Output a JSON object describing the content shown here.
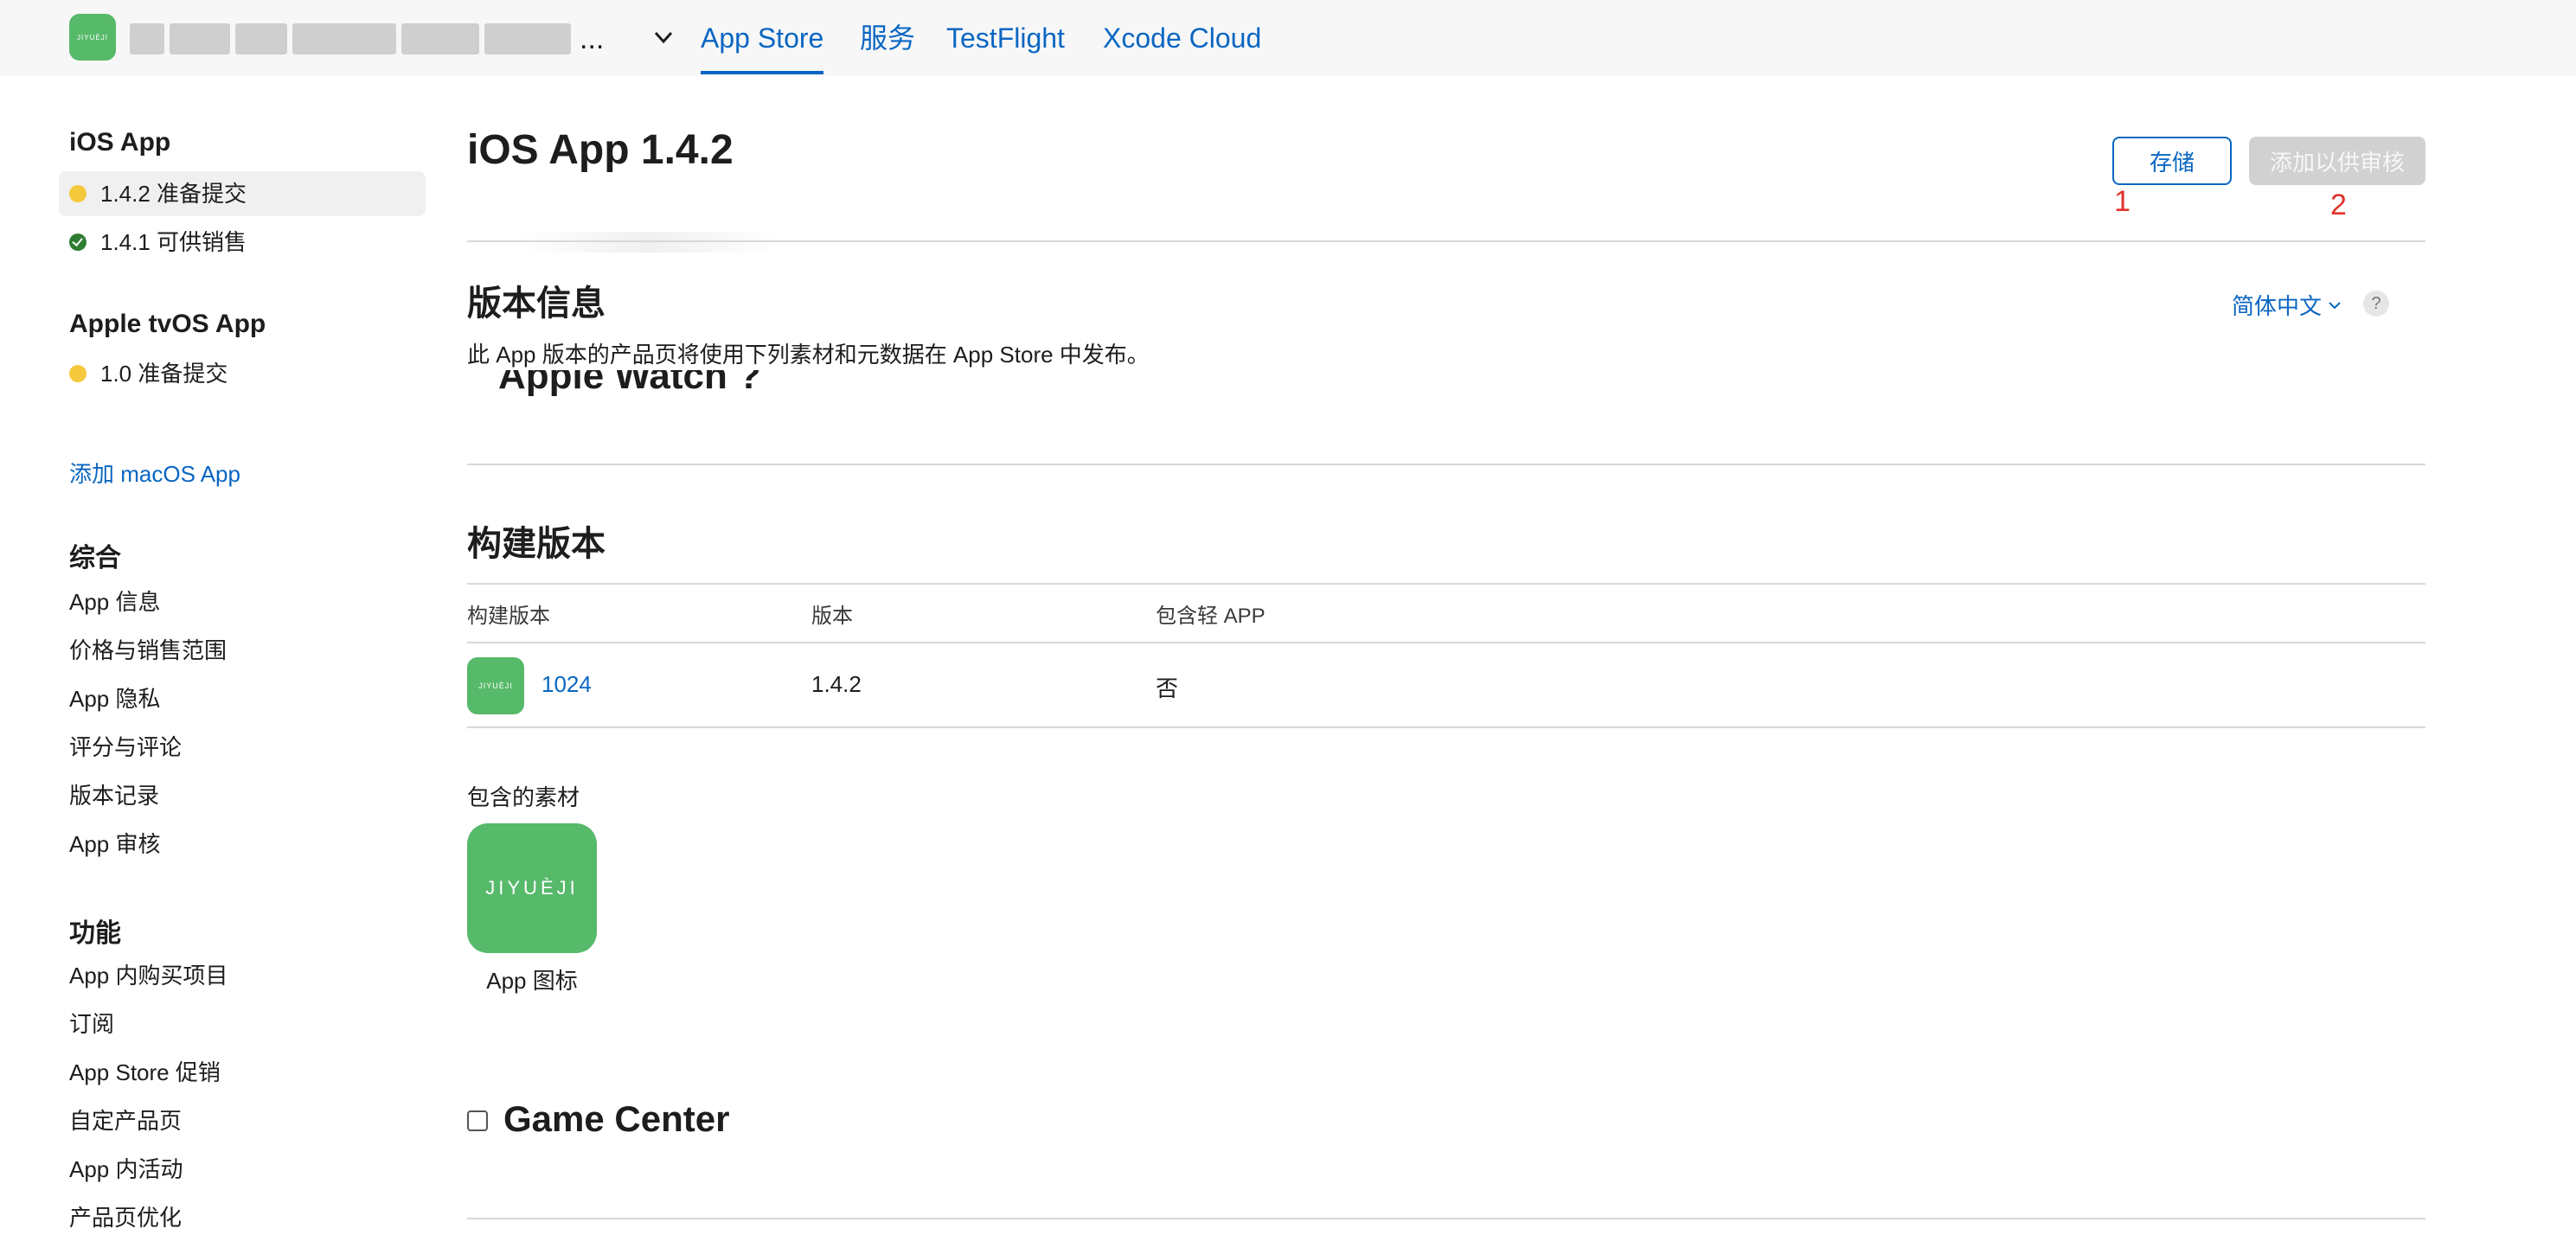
{
  "colors": {
    "accent": "#0a66c2",
    "app_green": "#57b96a",
    "status_yellow": "#f5c93c",
    "status_green": "#2e7d32",
    "annotation_red": "#e0332b"
  },
  "header": {
    "app_logo_text": "JIYUÈJI",
    "app_name_ellipsis": "...",
    "tabs": [
      "App Store",
      "服务",
      "TestFlight",
      "Xcode Cloud"
    ]
  },
  "sidebar": {
    "ios_title": "iOS App",
    "ios_versions": [
      {
        "label": "1.4.2 准备提交",
        "status": "yellow"
      },
      {
        "label": "1.4.1 可供销售",
        "status": "green"
      }
    ],
    "tvos_title": "Apple tvOS App",
    "tvos_versions": [
      {
        "label": "1.0 准备提交",
        "status": "yellow"
      }
    ],
    "add_macos": "添加 macOS App",
    "general_title": "综合",
    "general_items": [
      "App 信息",
      "价格与销售范围",
      "App 隐私",
      "评分与评论",
      "版本记录",
      "App 审核"
    ],
    "features_title": "功能",
    "features_items": [
      "App 内购买项目",
      "订阅",
      "App Store 促销",
      "自定产品页",
      "App 内活动",
      "产品页优化"
    ]
  },
  "main": {
    "title": "iOS App 1.4.2",
    "save_button": "存储",
    "submit_button": "添加以供审核",
    "annotation_1": "1",
    "annotation_2": "2",
    "version_info_title": "版本信息",
    "version_info_desc": "此 App 版本的产品页将使用下列素材和元数据在 App Store 中发布。",
    "language": "简体中文",
    "help": "?",
    "clipped_text": "Apple Watch ?",
    "build_title": "构建版本",
    "build_table": {
      "headers": [
        "构建版本",
        "版本",
        "包含轻 APP"
      ],
      "row": {
        "icon_text": "JIYUÈJI",
        "build": "1024",
        "version": "1.4.2",
        "app_clip": "否"
      }
    },
    "assets_label": "包含的素材",
    "asset_icon_text": "JIYUÈJI",
    "asset_caption": "App 图标",
    "game_center": "Game Center"
  }
}
